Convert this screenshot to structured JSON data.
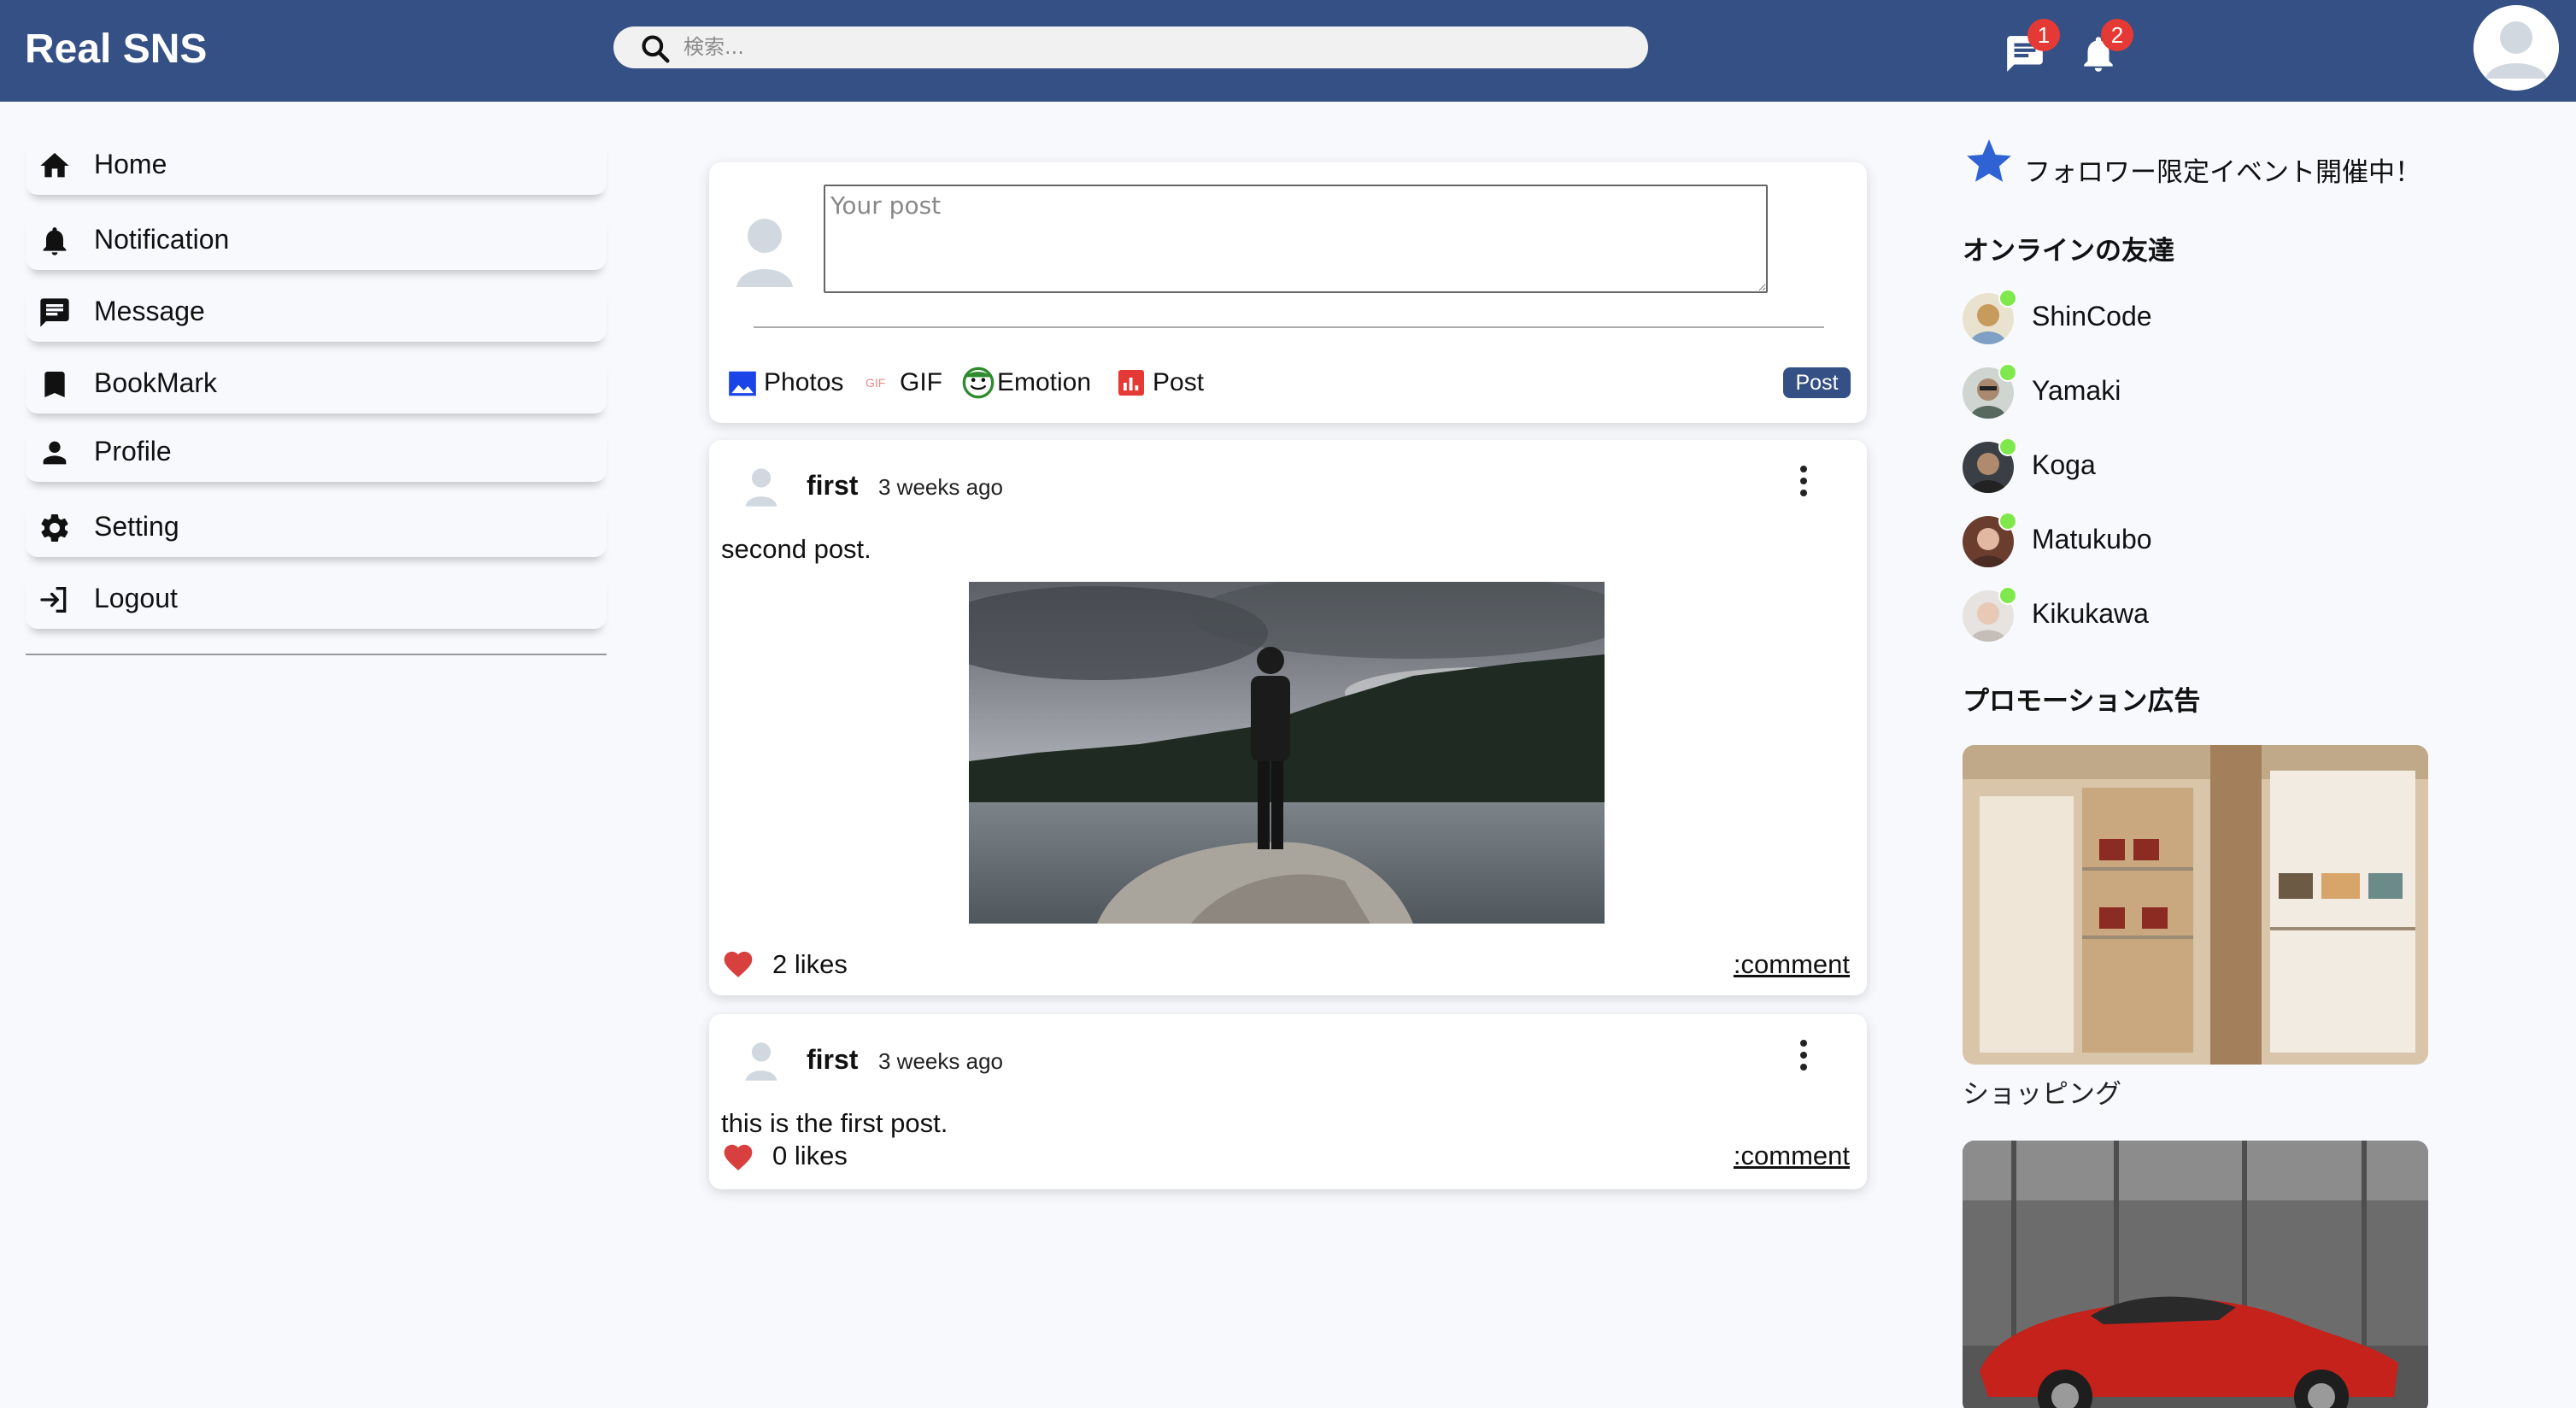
{
  "header": {
    "brand": "Real SNS",
    "search_placeholder": "検索...",
    "message_badge": "1",
    "notification_badge": "2"
  },
  "sidebar": {
    "items": [
      {
        "label": "Home",
        "icon": "home-icon"
      },
      {
        "label": "Notification",
        "icon": "bell-icon"
      },
      {
        "label": "Message",
        "icon": "chat-icon"
      },
      {
        "label": "BookMark",
        "icon": "bookmark-icon"
      },
      {
        "label": "Profile",
        "icon": "person-icon"
      },
      {
        "label": "Setting",
        "icon": "gear-icon"
      },
      {
        "label": "Logout",
        "icon": "logout-icon"
      }
    ]
  },
  "share": {
    "placeholder": "Your post",
    "options": {
      "photos": "Photos",
      "gif": "GIF",
      "emotion": "Emotion",
      "post": "Post"
    },
    "submit_label": "Post"
  },
  "posts": [
    {
      "username": "first",
      "time": "3 weeks ago",
      "text": "second post.",
      "likes": "2 likes",
      "comment": ":comment",
      "has_image": true
    },
    {
      "username": "first",
      "time": "3 weeks ago",
      "text": "this is the first post.",
      "likes": "0 likes",
      "comment": ":comment",
      "has_image": false
    }
  ],
  "rightbar": {
    "event_text": "フォロワー限定イベント開催中！",
    "online_title": "オンラインの友達",
    "friends": [
      "ShinCode",
      "Yamaki",
      "Koga",
      "Matukubo",
      "Kikukawa"
    ],
    "promo_title": "プロモーション広告",
    "promos": [
      {
        "caption": "ショッピング"
      }
    ]
  },
  "colors": {
    "header_bg": "#345084",
    "online_dot": "#7ee84c",
    "badge": "#e53935",
    "heart": "#d84040"
  }
}
